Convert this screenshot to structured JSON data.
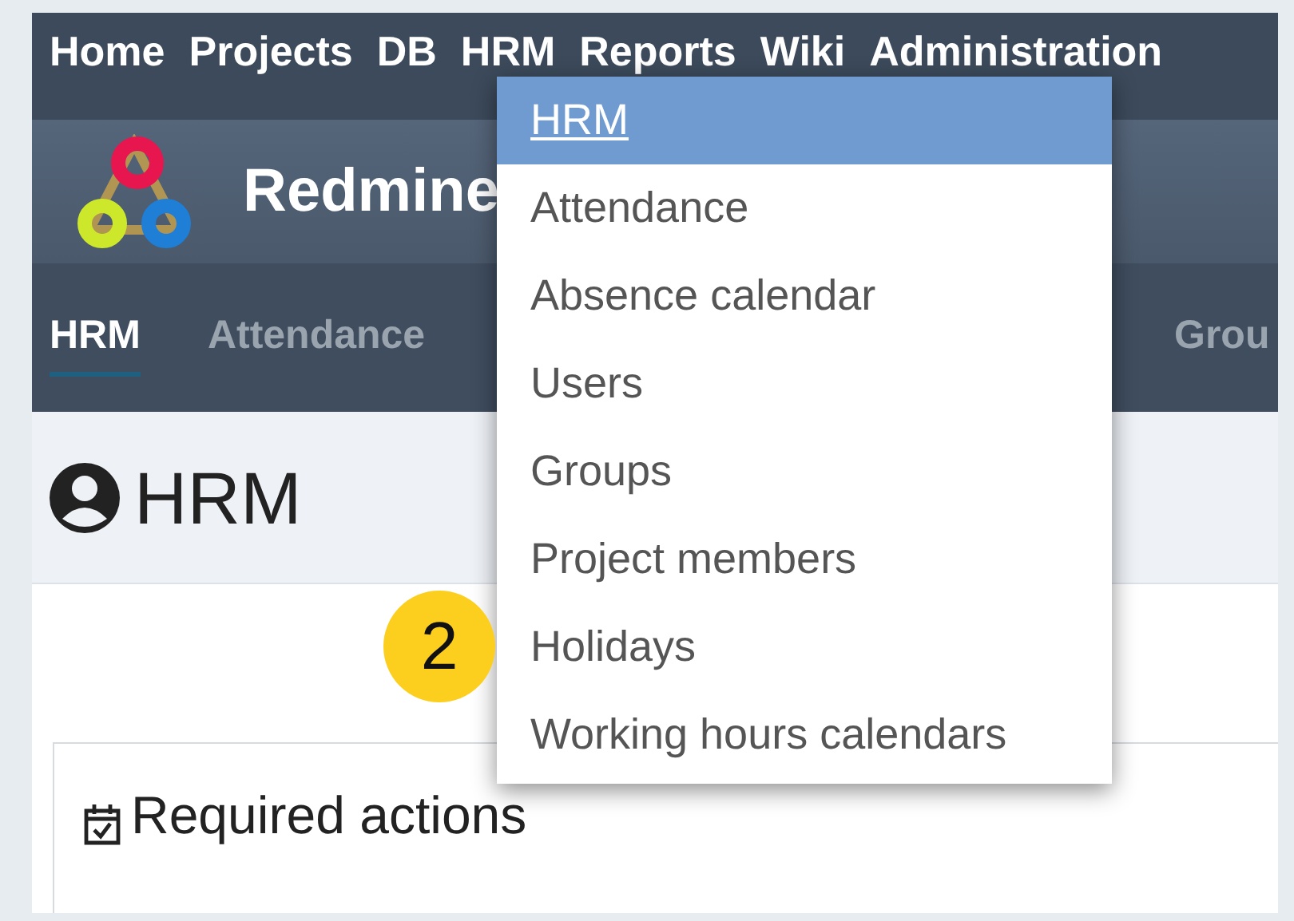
{
  "top_menu": [
    "Home",
    "Projects",
    "DB",
    "HRM",
    "Reports",
    "Wiki",
    "Administration"
  ],
  "header": {
    "title": "Redmine"
  },
  "tabs": [
    {
      "label": "HRM",
      "selected": true
    },
    {
      "label": "Attendance",
      "selected": false
    },
    {
      "label": "Grou",
      "selected": false
    }
  ],
  "page_title": "HRM",
  "card": {
    "title": "Required actions"
  },
  "dropdown": [
    {
      "label": "HRM",
      "selected": true
    },
    {
      "label": "Attendance",
      "selected": false
    },
    {
      "label": "Absence calendar",
      "selected": false
    },
    {
      "label": "Users",
      "selected": false
    },
    {
      "label": "Groups",
      "selected": false
    },
    {
      "label": "Project members",
      "selected": false
    },
    {
      "label": "Holidays",
      "selected": false
    },
    {
      "label": "Working hours calendars",
      "selected": false
    }
  ],
  "callout": "2"
}
